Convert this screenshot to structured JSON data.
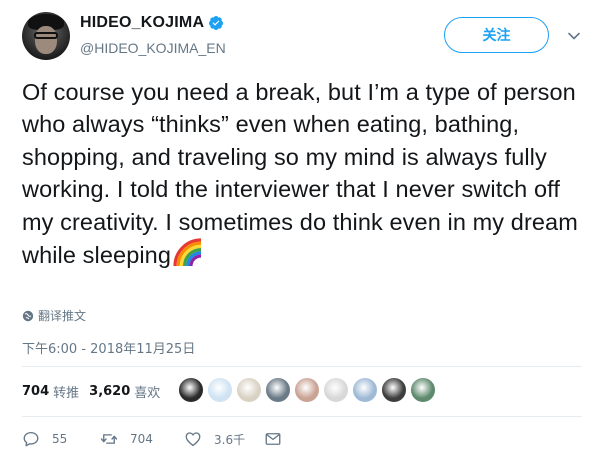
{
  "user": {
    "display_name": "HIDEO_KOJIMA",
    "handle": "@HIDEO_KOJIMA_EN",
    "verified": true
  },
  "follow_button": {
    "label": "关注"
  },
  "tweet": {
    "text": "Of course you need a break, but I’m a type of person who always “thinks” even when eating, bathing, shopping, and traveling so my mind is always fully working. I told the interviewer that I never switch off my creativity. I sometimes do think even in my dream while sleeping",
    "emoji": "rainbow-emoji",
    "translate_label": "翻译推文",
    "timestamp": "下午6:00 - 2018年11月25日"
  },
  "stats": {
    "retweets": {
      "count": "704",
      "label": "转推"
    },
    "likes": {
      "count": "3,620",
      "label": "喜欢"
    }
  },
  "liker_avatars": [
    {
      "name": "liker-avatar-1",
      "color": "#2b2b2b"
    },
    {
      "name": "liker-avatar-2",
      "color": "#cfe3f3"
    },
    {
      "name": "liker-avatar-3",
      "color": "#d9d2c4"
    },
    {
      "name": "liker-avatar-4",
      "color": "#6a7a86"
    },
    {
      "name": "liker-avatar-5",
      "color": "#c9a394"
    },
    {
      "name": "liker-avatar-6",
      "color": "#d8d8d8"
    },
    {
      "name": "liker-avatar-7",
      "color": "#9fbad6"
    },
    {
      "name": "liker-avatar-8",
      "color": "#3d3d3d"
    },
    {
      "name": "liker-avatar-9",
      "color": "#5f8a6e"
    }
  ],
  "actions": {
    "reply": {
      "icon": "reply-icon",
      "count": "55"
    },
    "retweet": {
      "icon": "retweet-icon",
      "count": "704"
    },
    "like": {
      "icon": "heart-icon",
      "count": "3.6千"
    },
    "dm": {
      "icon": "envelope-icon"
    }
  },
  "colors": {
    "accent": "#1da1f2",
    "text": "#14171a",
    "muted": "#657786",
    "divider": "#e6ecf0"
  }
}
